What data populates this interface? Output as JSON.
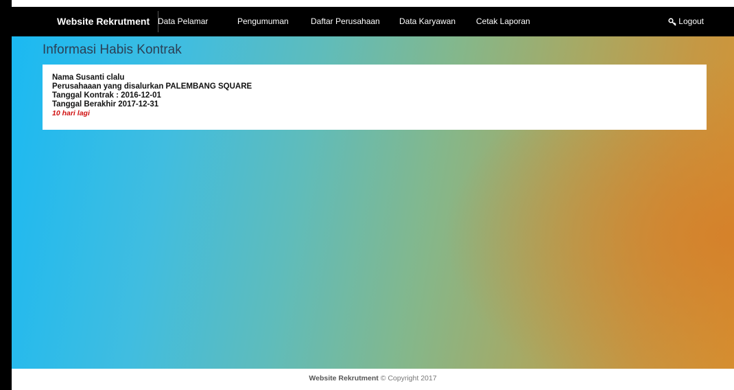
{
  "navbar": {
    "brand": "Website Rekrutment",
    "items": [
      {
        "label": "Data Pelamar"
      },
      {
        "label": "Pengumuman"
      },
      {
        "label": "Daftar Perusahaan"
      },
      {
        "label": "Data Karyawan"
      },
      {
        "label": "Cetak Laporan"
      }
    ],
    "logout_label": "Logout",
    "logout_icon": "key-icon"
  },
  "main": {
    "title": "Informasi Habis Kontrak",
    "card": {
      "name_line": "Nama Susanti clalu",
      "company_line": "Perusahaaan yang disalurkan PALEMBANG SQUARE",
      "start_line": "Tanggal Kontrak : 2016-12-01",
      "end_line": "Tanggal Berakhir 2017-12-31",
      "remaining": "10 hari lagi"
    }
  },
  "footer": {
    "brand": "Website Rekrutment",
    "copyright": "© Copyright 2017"
  },
  "colors": {
    "navbar_bg": "#000000",
    "remaining_text": "#d01010",
    "gradient_start": "#1bb9f2",
    "gradient_end": "#d69231"
  }
}
